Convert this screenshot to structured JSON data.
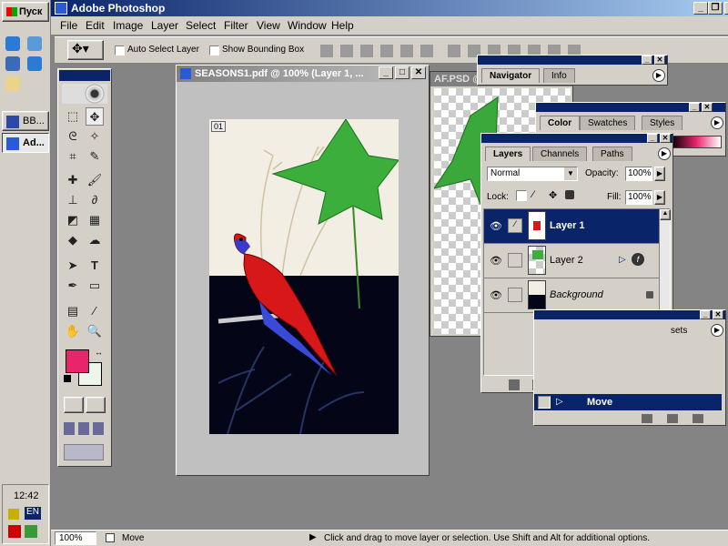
{
  "taskbar": {
    "start_label": "Пуск",
    "buttons": [
      {
        "label": "BB..."
      },
      {
        "label": "Ad..."
      }
    ],
    "clock": "12:42",
    "lang": "EN"
  },
  "app": {
    "title": "Adobe Photoshop"
  },
  "menu": [
    "File",
    "Edit",
    "Image",
    "Layer",
    "Select",
    "Filter",
    "View",
    "Window",
    "Help"
  ],
  "options": {
    "auto_select": "Auto Select Layer",
    "bounding_box": "Show Bounding Box"
  },
  "doc": {
    "title": "SEASONS1.pdf @ 100% (Layer 1, ...",
    "badge": "01",
    "back_title": "AF.PSD @"
  },
  "navigator": {
    "tabs": [
      "Navigator",
      "Info"
    ]
  },
  "color": {
    "tabs": [
      "Color",
      "Swatches",
      "Styles"
    ]
  },
  "layers": {
    "tabs": [
      "Layers",
      "Channels",
      "Paths"
    ],
    "blend_mode": "Normal",
    "opacity_label": "Opacity:",
    "opacity": "100%",
    "lock_label": "Lock:",
    "fill_label": "Fill:",
    "fill": "100%",
    "items": [
      {
        "name": "Layer 1",
        "selected": true
      },
      {
        "name": "Layer 2",
        "selected": false
      },
      {
        "name": "Background",
        "selected": false
      }
    ]
  },
  "actions": {
    "tab_partial": "sets",
    "item": "Move"
  },
  "status": {
    "zoom": "100%",
    "tool": "Move",
    "hint": "Click and drag to move layer or selection.  Use Shift and Alt for additional options."
  },
  "colors": {
    "foreground": "#e8246a",
    "background": "#eef5ea",
    "titlebar": "#0a246a"
  }
}
